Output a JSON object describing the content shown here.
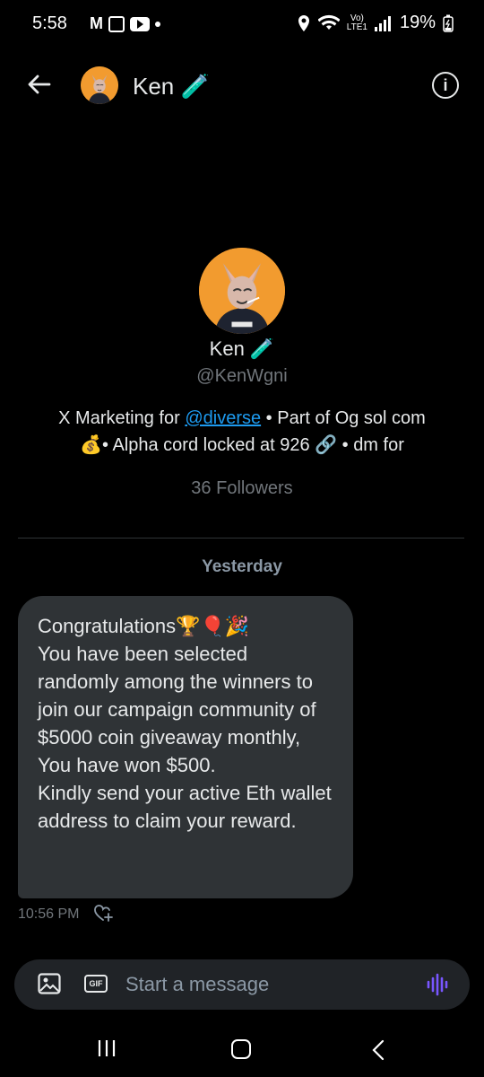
{
  "status_bar": {
    "time": "5:58",
    "battery": "19%"
  },
  "header": {
    "name": "Ken 🧪"
  },
  "profile": {
    "name": "Ken 🧪",
    "handle": "@KenWgni",
    "bio_line1_pre": "X Marketing for ",
    "bio_link": "@diverse",
    "bio_line1_post": " • Part of Og sol com",
    "bio_line2": "💰• Alpha cord locked at 926 🔗 • dm for",
    "followers": "36 Followers"
  },
  "conversation": {
    "day_label": "Yesterday",
    "message": {
      "text": "Congratulations🏆🎈🎉\nYou have been selected randomly among the winners to join our campaign community of $5000 coin giveaway monthly,\nYou have won $500.\nKindly send your active Eth wallet address to claim your reward.",
      "time": "10:56 PM"
    }
  },
  "composer": {
    "placeholder": "Start a message",
    "gif_label": "GIF"
  },
  "colors": {
    "accent": "#1d9bf0",
    "bubble": "#2f3336",
    "voice": "#7856ff"
  }
}
